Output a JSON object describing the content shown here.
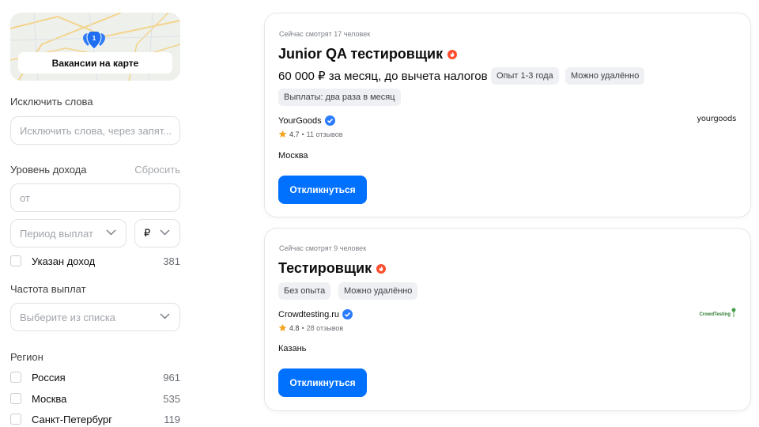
{
  "sidebar": {
    "map_button_label": "Вакансии на карте",
    "map_pin_count": "1",
    "exclude_words": {
      "label": "Исключить слова",
      "placeholder": "Исключить слова, через запят..."
    },
    "income": {
      "label": "Уровень дохода",
      "reset_label": "Сбросить",
      "from_placeholder": "от",
      "period_placeholder": "Период выплат",
      "currency": "₽"
    },
    "income_specified": {
      "label": "Указан доход",
      "count": "381",
      "checked": false
    },
    "payment_frequency": {
      "label": "Частота выплат",
      "placeholder": "Выберите из списка"
    },
    "region": {
      "label": "Регион",
      "items": [
        {
          "label": "Россия",
          "count": "961",
          "checked": false
        },
        {
          "label": "Москва",
          "count": "535",
          "checked": false
        },
        {
          "label": "Санкт-Петербург",
          "count": "119",
          "checked": false
        }
      ]
    }
  },
  "vacancies": [
    {
      "viewers": "Сейчас смотрят 17 человек",
      "title": "Junior QA тестировщик",
      "salary": "60 000 ₽ за месяц, до вычета налогов",
      "tags": [
        "Опыт 1-3 года",
        "Можно удалённо"
      ],
      "tags_row2": [
        "Выплаты: два раза в месяц"
      ],
      "company": "YourGoods",
      "rating": "4.7",
      "reviews": "11 отзывов",
      "city": "Москва",
      "respond_label": "Откликнуться",
      "logo_text": "yourgoods"
    },
    {
      "viewers": "Сейчас смотрят 9 человек",
      "title": "Тестировщик",
      "tags": [
        "Без опыта",
        "Можно удалённо"
      ],
      "company": "Crowdtesting.ru",
      "rating": "4.8",
      "reviews": "28 отзывов",
      "city": "Казань",
      "respond_label": "Откликнуться",
      "logo_text": "CrowdTesting"
    }
  ],
  "colors": {
    "accent": "#0070ff",
    "hot": "#ff4d2e",
    "verified": "#2b7cff",
    "star": "#f5a623",
    "chip_bg": "#eef0f3"
  }
}
